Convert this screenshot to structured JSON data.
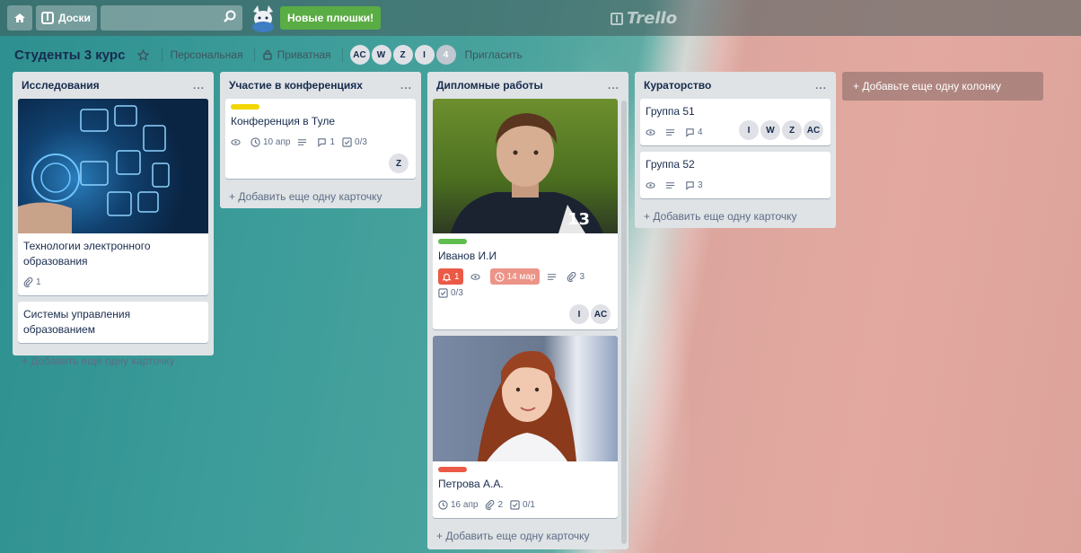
{
  "header": {
    "boards_label": "Доски",
    "promo_label": "Новые плюшки!",
    "logo_text": "Trello"
  },
  "board": {
    "title": "Студенты 3 курс",
    "visibility_team": "Персональная",
    "visibility_private": "Приватная",
    "members": [
      "AC",
      "W",
      "Z",
      "I"
    ],
    "extra_members": "4",
    "invite_label": "Пригласить"
  },
  "lists": [
    {
      "title": "Исследования",
      "cards": [
        {
          "title": "Технологии электронного образования",
          "attachments": "1"
        },
        {
          "title": "Системы управления образованием"
        }
      ],
      "add_card": "+ Добавить еще одну карточку"
    },
    {
      "title": "Участие в конференциях",
      "cards": [
        {
          "title": "Конференция в Туле",
          "label_color": "#f2d600",
          "due": "10 апр",
          "comments": "1",
          "checklist": "0/3",
          "members": [
            "Z"
          ]
        }
      ],
      "add_card": "+ Добавить еще одну карточку"
    },
    {
      "title": "Дипломные работы",
      "cards": [
        {
          "title": "Иванов И.И",
          "label_color": "#61bd4f",
          "notifications": "1",
          "due": "14 мар",
          "attachments": "3",
          "checklist": "0/3",
          "members": [
            "I",
            "AC"
          ]
        },
        {
          "title": "Петрова А.А.",
          "label_color": "#eb5a46",
          "due": "16 апр",
          "attachments": "2",
          "checklist": "0/1"
        }
      ],
      "add_card": "+ Добавить еще одну карточку"
    },
    {
      "title": "Кураторство",
      "cards": [
        {
          "title": "Группа 51",
          "comments": "4",
          "members": [
            "I",
            "W",
            "Z",
            "AC"
          ]
        },
        {
          "title": "Группа 52",
          "comments": "3"
        }
      ],
      "add_card": "+ Добавить еще одну карточку"
    }
  ],
  "add_list_label": "+ Добавьте еще одну колонку",
  "list_menu": "...",
  "colors": {
    "promo": "#5aac44",
    "due_overdue": "#eb5a46"
  }
}
